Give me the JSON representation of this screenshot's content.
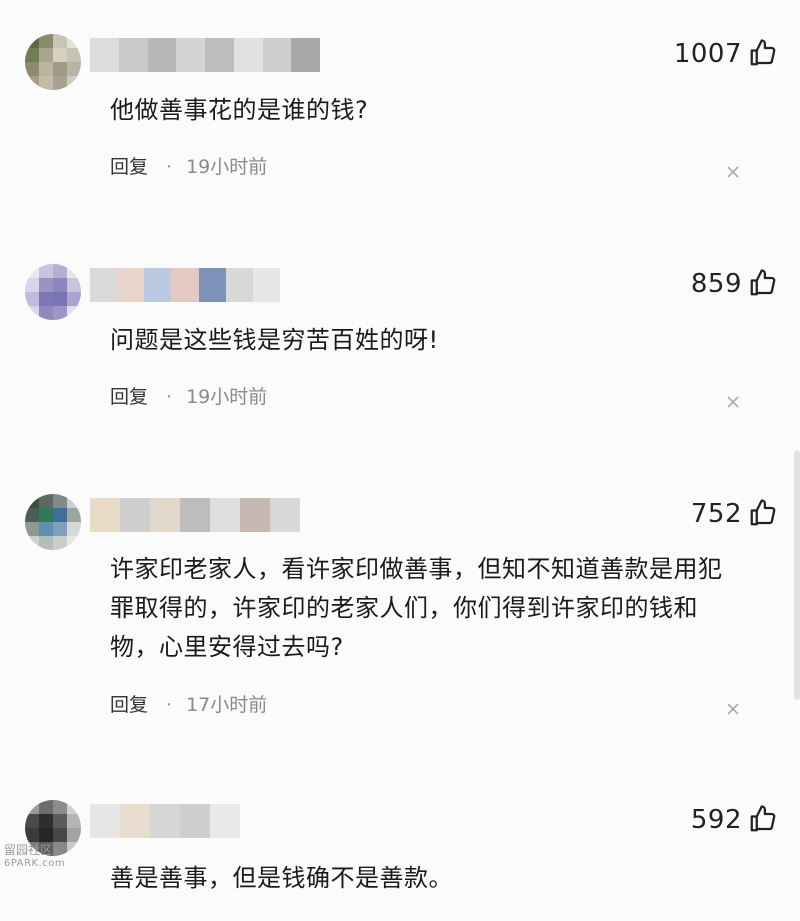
{
  "comments": [
    {
      "likes": "1007",
      "text": "他做善事花的是谁的钱?",
      "reply_label": "回复",
      "separator": "·",
      "time": "19小时前"
    },
    {
      "likes": "859",
      "text": "问题是这些钱是穷苦百姓的呀!",
      "reply_label": "回复",
      "separator": "·",
      "time": "19小时前"
    },
    {
      "likes": "752",
      "text": "许家印老家人，看许家印做善事，但知不知道善款是用犯罪取得的，许家印的老家人们，你们得到许家印的钱和物，心里安得过去吗?",
      "reply_label": "回复",
      "separator": "·",
      "time": "17小时前"
    },
    {
      "likes": "592",
      "text": "善是善事，但是钱确不是善款。"
    }
  ],
  "watermark": {
    "line1": "留园社区",
    "line2": "6PARK.com"
  },
  "icons": {
    "like": "thumbs-up-icon",
    "dismiss": "close-icon"
  },
  "colors": {
    "background": "#fbfbfb",
    "text": "#1a1a1a",
    "meta": "#8a8a8a"
  }
}
